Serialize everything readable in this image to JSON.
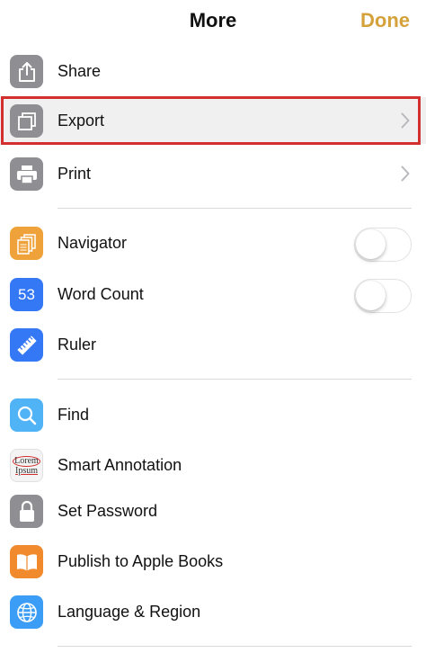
{
  "header": {
    "title": "More",
    "done_label": "Done"
  },
  "colors": {
    "accent": "#d4a13a",
    "highlight_border": "#d32f2f",
    "gray_icon": "#8e8e93",
    "orange_icon": "#f0a23a",
    "blue_icon": "#3478f6",
    "light_blue_icon": "#4fb3f6"
  },
  "items": {
    "share": {
      "label": "Share",
      "icon": "share-icon"
    },
    "export": {
      "label": "Export",
      "icon": "export-icon"
    },
    "print": {
      "label": "Print",
      "icon": "print-icon"
    },
    "navigator": {
      "label": "Navigator",
      "icon": "navigator-icon",
      "toggle_on": false
    },
    "word_count": {
      "label": "Word Count",
      "icon": "word-count-icon",
      "icon_text": "53",
      "toggle_on": false
    },
    "ruler": {
      "label": "Ruler",
      "icon": "ruler-icon"
    },
    "find": {
      "label": "Find",
      "icon": "search-icon"
    },
    "smart_annotation": {
      "label": "Smart Annotation",
      "icon": "smart-annotation-icon",
      "icon_text_1": "Lorem",
      "icon_text_2": "Ipsum"
    },
    "set_password": {
      "label": "Set Password",
      "icon": "lock-icon"
    },
    "publish_books": {
      "label": "Publish to Apple Books",
      "icon": "book-icon"
    },
    "language_region": {
      "label": "Language & Region",
      "icon": "globe-icon"
    }
  }
}
